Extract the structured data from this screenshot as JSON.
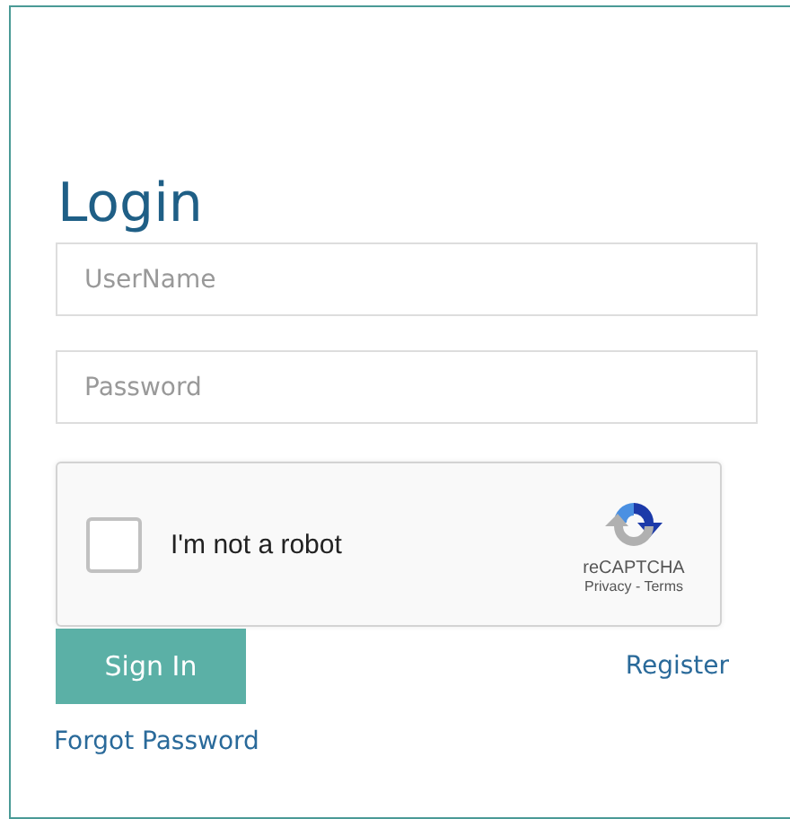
{
  "title": "Login",
  "fields": [
    {
      "placeholder": "UserName"
    },
    {
      "placeholder": "Password"
    }
  ],
  "captcha": {
    "label": "I'm not a robot",
    "checked": false,
    "brand": "reCAPTCHA",
    "links": "Privacy - Terms"
  },
  "sign_in": "Sign In",
  "register": "Register",
  "forgot": "Forgot Password"
}
